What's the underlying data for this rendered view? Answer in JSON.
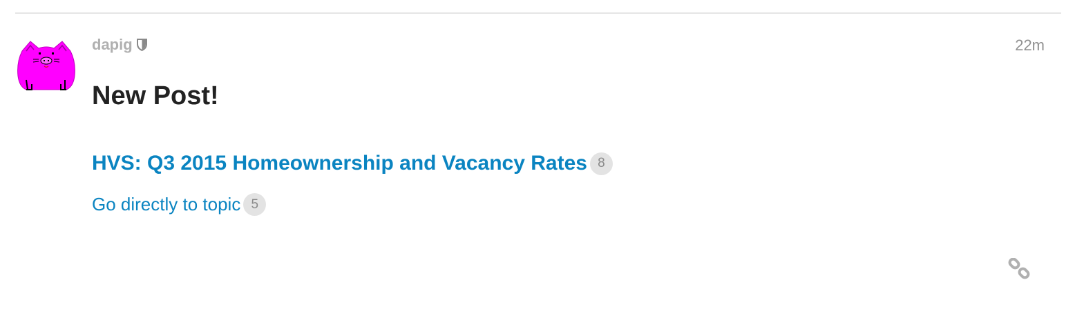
{
  "post": {
    "username": "dapig",
    "timestamp": "22m",
    "title": "New Post!",
    "topic_link": "HVS: Q3 2015 Homeownership and Vacancy Rates",
    "topic_count": "8",
    "goto_link": "Go directly to topic",
    "goto_count": "5"
  },
  "icons": {
    "avatar": "pink-pig-avatar",
    "moderator": "shield-icon",
    "share": "link-icon"
  },
  "colors": {
    "link": "#0a84c1",
    "avatar": "#ff00ff",
    "muted": "#b0b0b0"
  }
}
